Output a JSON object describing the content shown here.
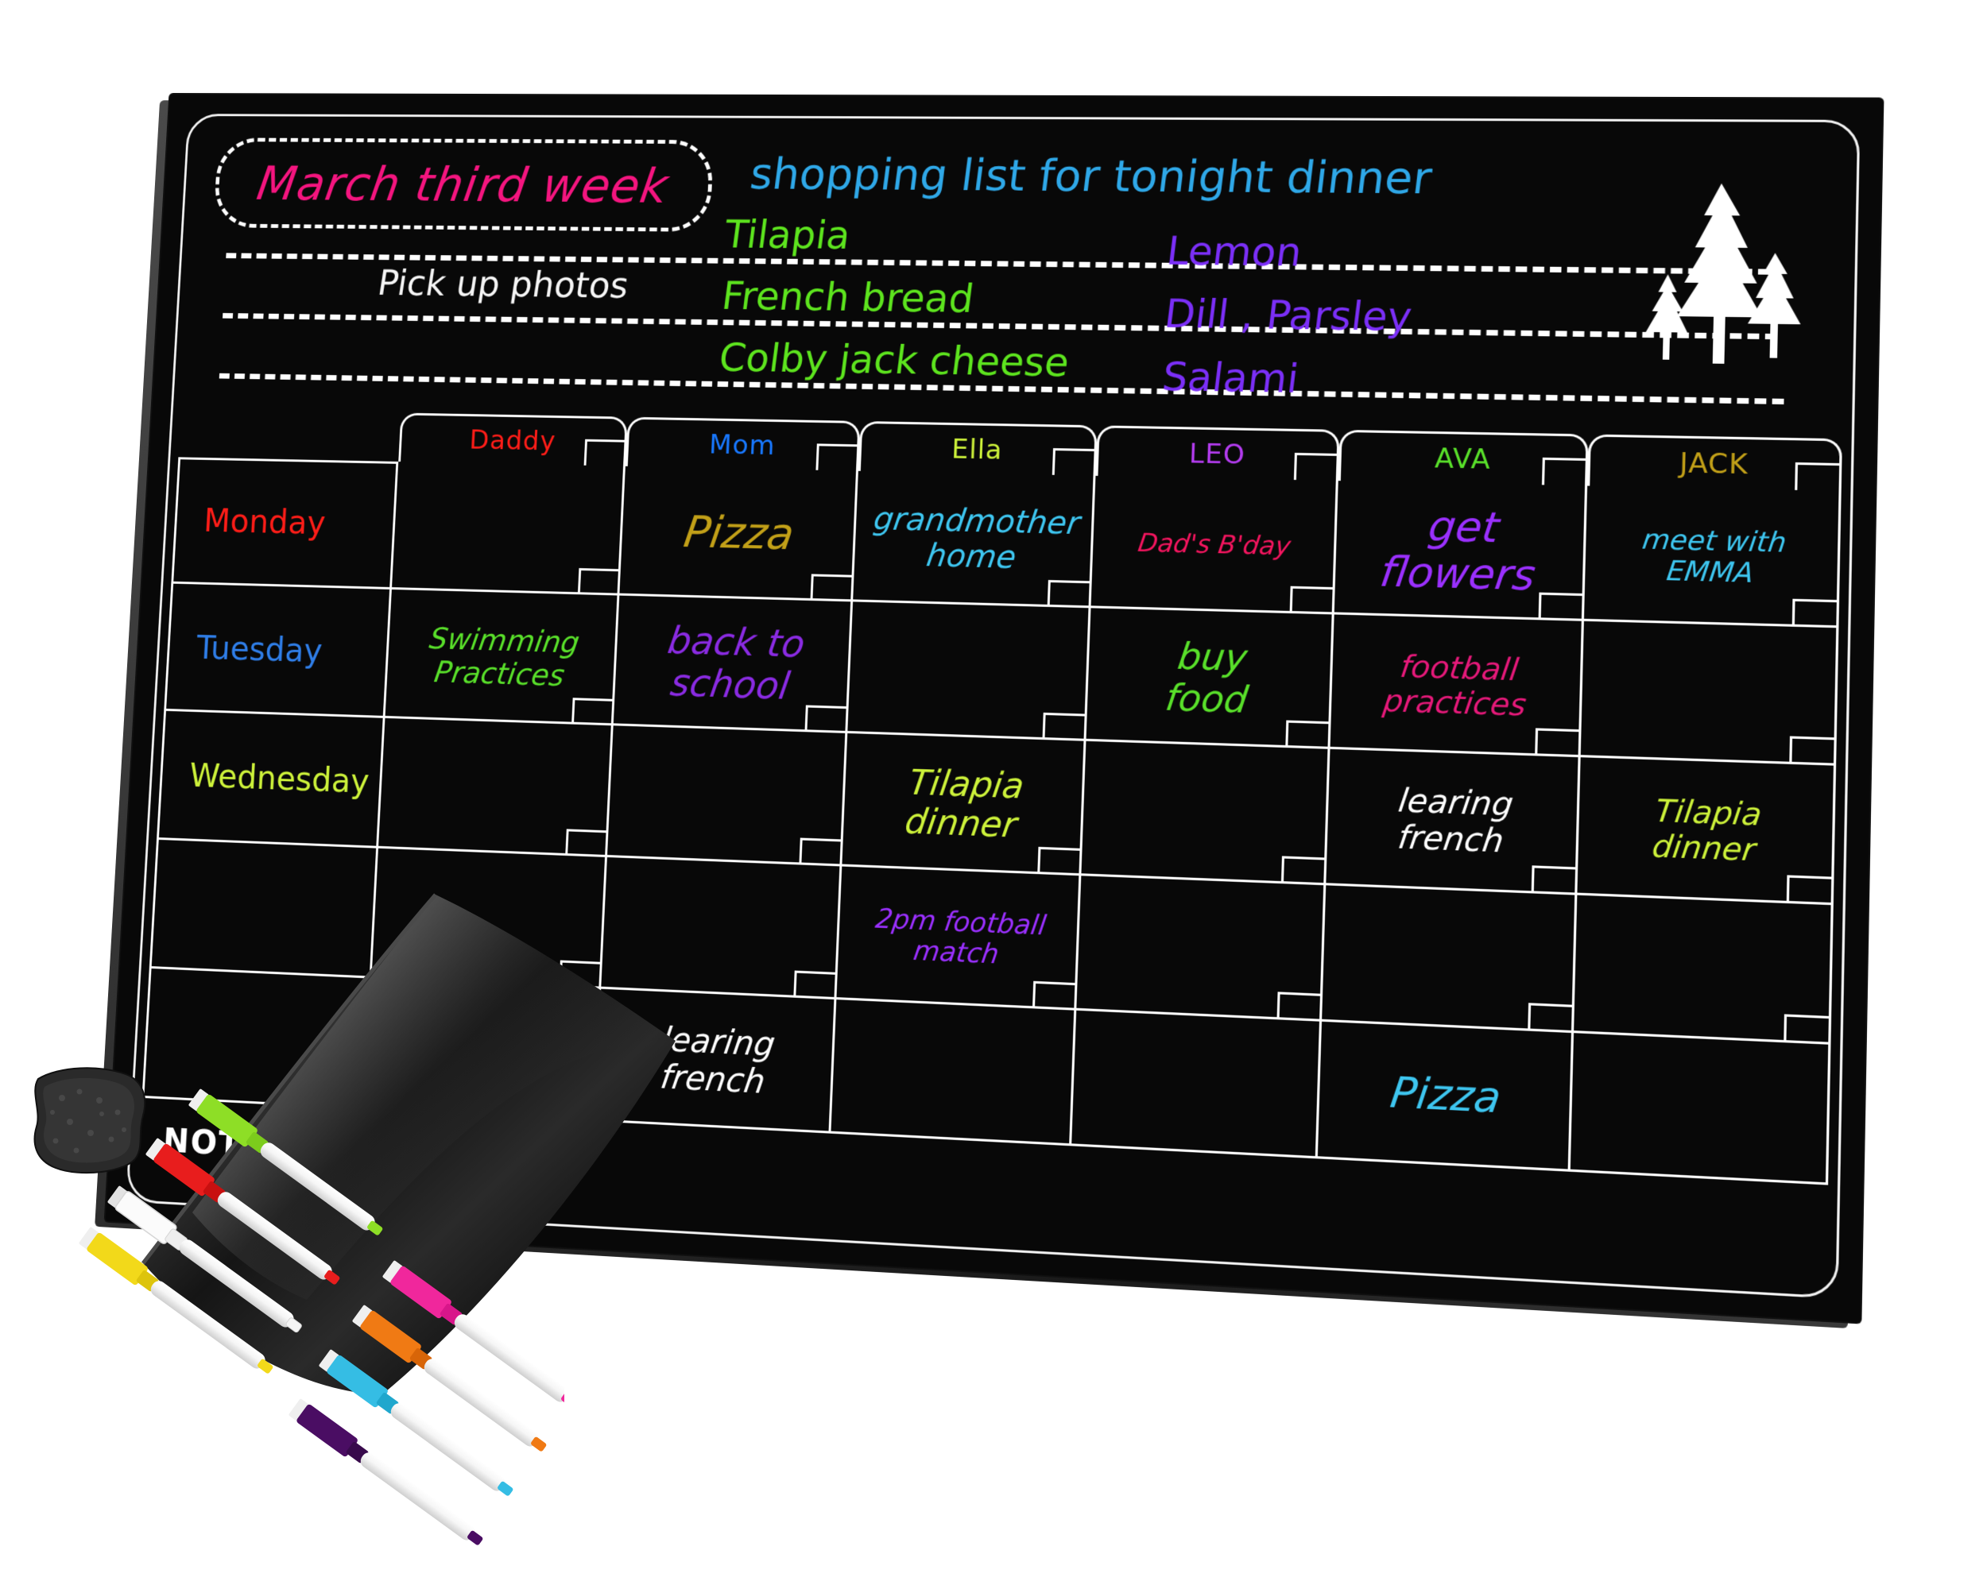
{
  "product": {
    "kind": "magnetic-dry-erase-calendar-board",
    "notes_label": "NOTES:"
  },
  "header": {
    "week_title": "March third week",
    "shopping_title": "shopping list for tonight dinner",
    "reminder": "Pick up photos",
    "shopping_left": [
      "Tilapia",
      "French bread",
      "Colby jack cheese"
    ],
    "shopping_right": [
      "Lemon",
      "Dill , Parsley",
      "Salami"
    ]
  },
  "colors": {
    "pink": "#f4157f",
    "blue": "#2fa8e8",
    "green": "#5de41e",
    "purple": "#7b2ff7",
    "red": "#ff1d18",
    "cyan": "#3ec6f0",
    "yellow_green": "#cdf23a",
    "olive": "#c2a018",
    "white": "#ffffff",
    "magenta": "#e6197a",
    "grass": "#59c926",
    "violet": "#9b30ff",
    "board": "#080808"
  },
  "grid": {
    "day_header": "",
    "columns": [
      {
        "label": "Daddy",
        "color": "#ff1d18"
      },
      {
        "label": "Mom",
        "color": "#1878ff"
      },
      {
        "label": "Ella",
        "color": "#cdf23a"
      },
      {
        "label": "LEO",
        "color": "#b43cf0"
      },
      {
        "label": "AVA",
        "color": "#59e02a"
      },
      {
        "label": "JACK",
        "color": "#c2a018"
      }
    ],
    "days": [
      {
        "label": "Monday",
        "color": "#ff1d18"
      },
      {
        "label": "Tuesday",
        "color": "#2f7ee8"
      },
      {
        "label": "Wednesday",
        "color": "#cdf23a"
      },
      {
        "label": "",
        "color": "#ffffff"
      },
      {
        "label": "",
        "color": "#ffffff"
      }
    ],
    "entries": [
      {
        "row": 0,
        "col": 1,
        "text": "Pizza",
        "color": "#c2a018",
        "size": 56
      },
      {
        "row": 0,
        "col": 2,
        "text": "grandmother\nhome",
        "color": "#3ec6f0",
        "size": 40
      },
      {
        "row": 0,
        "col": 3,
        "text": "Dad's B'day",
        "color": "#f4155f",
        "size": 32
      },
      {
        "row": 0,
        "col": 4,
        "text": "get\nflowers",
        "color": "#9b30ff",
        "size": 52
      },
      {
        "row": 0,
        "col": 5,
        "text": "meet with\nEMMA",
        "color": "#3ec6f0",
        "size": 34
      },
      {
        "row": 1,
        "col": 0,
        "text": "Swimming\nPractices",
        "color": "#59e02a",
        "size": 38
      },
      {
        "row": 1,
        "col": 1,
        "text": "back to\nschool",
        "color": "#8a2be2",
        "size": 48
      },
      {
        "row": 1,
        "col": 3,
        "text": "buy\nfood",
        "color": "#59e02a",
        "size": 46
      },
      {
        "row": 1,
        "col": 4,
        "text": "football\npractices",
        "color": "#e6197a",
        "size": 38
      },
      {
        "row": 2,
        "col": 2,
        "text": "Tilapia\ndinner",
        "color": "#cdf23a",
        "size": 44
      },
      {
        "row": 2,
        "col": 4,
        "text": "learing\nfrench",
        "color": "#ffffff",
        "size": 40
      },
      {
        "row": 2,
        "col": 5,
        "text": "Tilapia\ndinner",
        "color": "#cdf23a",
        "size": 38
      },
      {
        "row": 3,
        "col": 2,
        "text": "2pm football\nmatch",
        "color": "#9b30ff",
        "size": 34
      },
      {
        "row": 4,
        "col": 1,
        "text": "learing\nfrench",
        "color": "#ffffff",
        "size": 42
      },
      {
        "row": 4,
        "col": 4,
        "text": "Pizza",
        "color": "#3ec6f0",
        "size": 52
      }
    ]
  },
  "supplies": {
    "eraser": {
      "name": "magnetic-eraser",
      "color": "#2b2b2b"
    },
    "markers": [
      {
        "name": "green-marker",
        "color": "#8ede26"
      },
      {
        "name": "red-marker",
        "color": "#e81d1d"
      },
      {
        "name": "white-marker",
        "color": "#f4f4f4"
      },
      {
        "name": "yellow-marker",
        "color": "#f2d91a"
      },
      {
        "name": "magenta-marker",
        "color": "#f0279c"
      },
      {
        "name": "orange-marker",
        "color": "#f07a14"
      },
      {
        "name": "cyan-marker",
        "color": "#35bde4"
      },
      {
        "name": "purple-marker",
        "color": "#4a0d63"
      }
    ]
  }
}
